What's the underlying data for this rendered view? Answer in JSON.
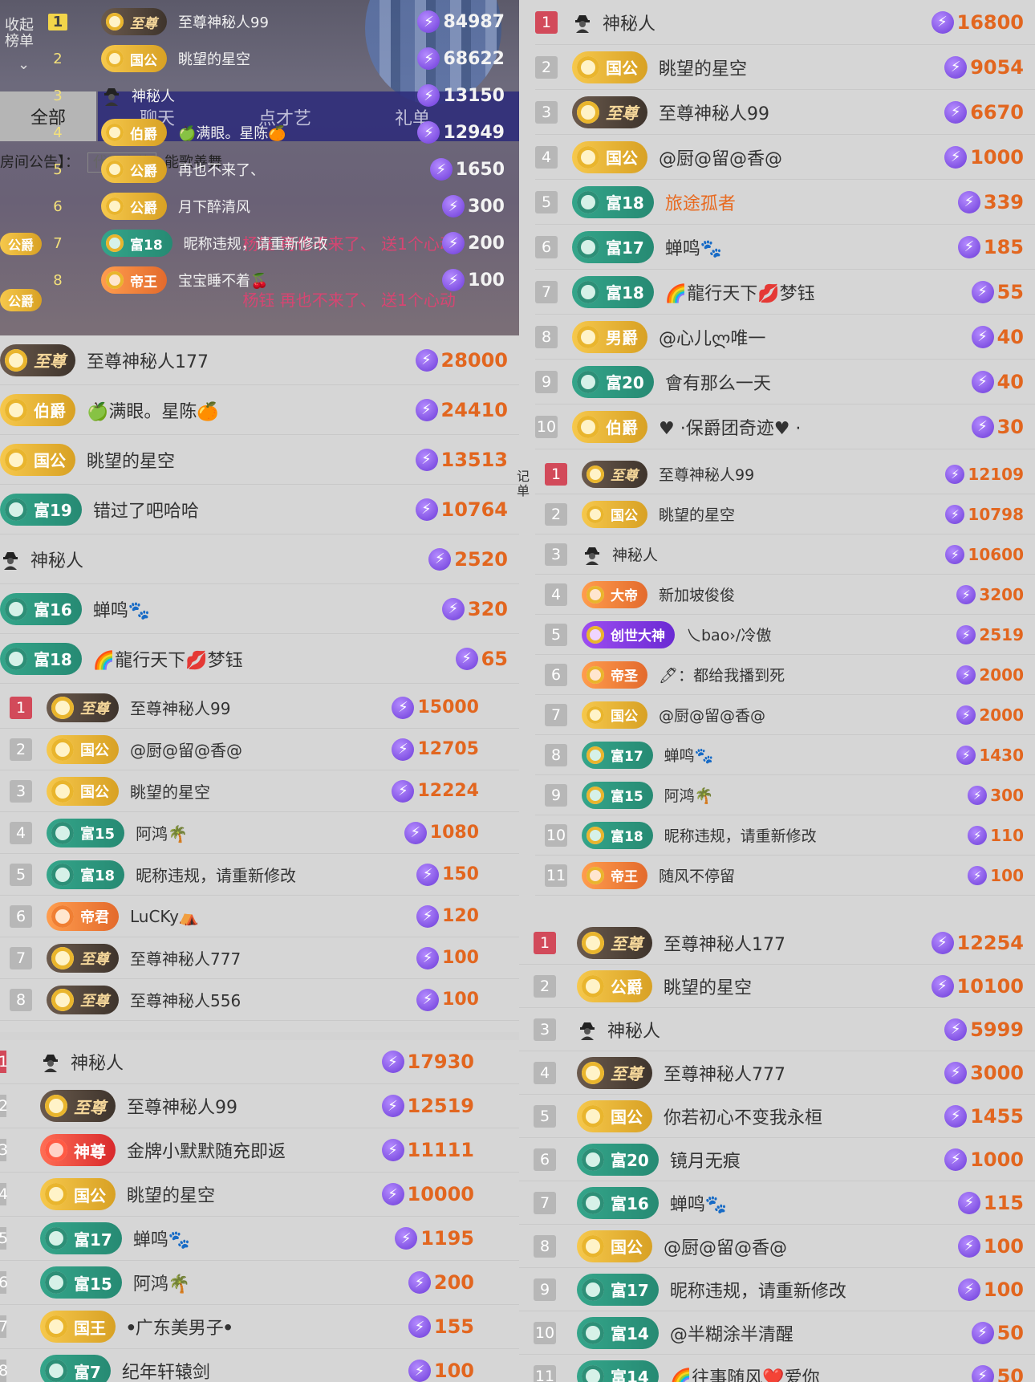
{
  "overlay": {
    "sidebar_label": "收起\n榜单",
    "tabs": {
      "all": "全部",
      "chat": "聊天",
      "talent": "点才艺",
      "gift": "礼单"
    },
    "notice_prefix": "房间公告】：",
    "notice_chip": "代理充值",
    "notice_text": "能歌善舞",
    "rows": [
      {
        "rank": "1",
        "badge": "至尊",
        "badge_type": "dark",
        "name": "至尊神秘人99",
        "score": "84987"
      },
      {
        "rank": "2",
        "badge": "国公",
        "badge_type": "gold",
        "name": "眺望的星空",
        "score": "68622"
      },
      {
        "rank": "3",
        "badge": "",
        "badge_type": "avatar",
        "name": "神秘人",
        "score": "13150"
      },
      {
        "rank": "4",
        "badge": "伯爵",
        "badge_type": "gold",
        "name": "🍏满眼。星陈🍊",
        "score": "12949"
      },
      {
        "rank": "5",
        "badge": "公爵",
        "badge_type": "gold",
        "name": "再也不来了、",
        "score": "1650"
      },
      {
        "rank": "6",
        "badge": "公爵",
        "badge_type": "gold",
        "name": "月下醉清风",
        "score": "300"
      },
      {
        "rank": "7",
        "badge": "富18",
        "badge_type": "green",
        "name": "昵称违规，请重新修改",
        "score": "200"
      },
      {
        "rank": "8",
        "badge": "帝王",
        "badge_type": "orange",
        "name": "宝宝睡不着🍒",
        "score": "100"
      }
    ],
    "chat_lines": [
      "杨钰  再也不来了、 送1个心动",
      "杨钰  再也不来了、 送1个心动"
    ],
    "chat_badges": [
      "公爵",
      "公爵"
    ]
  },
  "top_right": [
    {
      "rank": "1",
      "badge": "",
      "badge_type": "avatar",
      "name": "神秘人",
      "score": "16800"
    },
    {
      "rank": "2",
      "badge": "国公",
      "badge_type": "gold",
      "name": "眺望的星空",
      "score": "9054"
    },
    {
      "rank": "3",
      "badge": "至尊",
      "badge_type": "dark",
      "name": "至尊神秘人99",
      "score": "6670"
    },
    {
      "rank": "4",
      "badge": "国公",
      "badge_type": "gold",
      "name": "@厨@留@香@",
      "score": "1000"
    },
    {
      "rank": "5",
      "badge": "富18",
      "badge_type": "green",
      "name": "旅途孤者",
      "name_color": "orange",
      "score": "339"
    },
    {
      "rank": "6",
      "badge": "富17",
      "badge_type": "green",
      "name": "蝉鸣🐾",
      "score": "185"
    },
    {
      "rank": "7",
      "badge": "富18",
      "badge_type": "green",
      "name": "🌈龍行天下💋梦钰",
      "score": "55"
    },
    {
      "rank": "8",
      "badge": "男爵",
      "badge_type": "gold",
      "name": "@心儿ლ唯一",
      "score": "40"
    },
    {
      "rank": "9",
      "badge": "富20",
      "badge_type": "green",
      "name": "會有那么一天",
      "score": "40"
    },
    {
      "rank": "10",
      "badge": "伯爵",
      "badge_type": "gold",
      "name": "♥ ·保爵团奇迹♥ ·",
      "score": "30"
    }
  ],
  "mid_left": [
    {
      "badge": "至尊",
      "badge_type": "dark",
      "name": "至尊神秘人177",
      "score": "28000"
    },
    {
      "badge": "伯爵",
      "badge_type": "gold",
      "name": "🍏满眼。星陈🍊",
      "score": "24410"
    },
    {
      "badge": "国公",
      "badge_type": "gold",
      "name": "眺望的星空",
      "score": "13513"
    },
    {
      "badge": "富19",
      "badge_type": "green",
      "name": "错过了吧哈哈",
      "score": "10764"
    },
    {
      "badge": "",
      "badge_type": "avatar",
      "name": "神秘人",
      "score": "2520"
    },
    {
      "badge": "富16",
      "badge_type": "green",
      "name": "蝉鸣🐾",
      "score": "320"
    },
    {
      "badge": "富18",
      "badge_type": "green",
      "name": "🌈龍行天下💋梦钰",
      "score": "65"
    }
  ],
  "mid_right": [
    {
      "rank": "1",
      "badge": "至尊",
      "badge_type": "dark",
      "name": "至尊神秘人99",
      "score": "12109"
    },
    {
      "rank": "2",
      "badge": "国公",
      "badge_type": "gold",
      "name": "眺望的星空",
      "score": "10798"
    },
    {
      "rank": "3",
      "badge": "",
      "badge_type": "avatar",
      "name": "神秘人",
      "score": "10600"
    },
    {
      "rank": "4",
      "badge": "大帝",
      "badge_type": "orange",
      "name": "新加坡俊俊",
      "score": "3200"
    },
    {
      "rank": "5",
      "badge": "创世大神",
      "badge_type": "purple",
      "name": "乀bao›∕冷傲",
      "score": "2519"
    },
    {
      "rank": "6",
      "badge": "帝圣",
      "badge_type": "orange",
      "name": "🖊：都给我播到死",
      "score": "2000"
    },
    {
      "rank": "7",
      "badge": "国公",
      "badge_type": "gold",
      "name": "@厨@留@香@",
      "score": "2000"
    },
    {
      "rank": "8",
      "badge": "富17",
      "badge_type": "green",
      "name": "蝉鸣🐾",
      "score": "1430"
    },
    {
      "rank": "9",
      "badge": "富15",
      "badge_type": "green",
      "name": "阿鸿🌴",
      "score": "300"
    },
    {
      "rank": "10",
      "badge": "富18",
      "badge_type": "green",
      "name": "昵称违规，请重新修改",
      "score": "110"
    },
    {
      "rank": "11",
      "badge": "帝王",
      "badge_type": "orange",
      "name": "随风不停留",
      "score": "100"
    }
  ],
  "edge_text": "记\n单",
  "mid_left_b": [
    {
      "rank": "1",
      "badge": "至尊",
      "badge_type": "dark",
      "name": "至尊神秘人99",
      "score": "15000"
    },
    {
      "rank": "2",
      "badge": "国公",
      "badge_type": "gold",
      "name": "@厨@留@香@",
      "score": "12705"
    },
    {
      "rank": "3",
      "badge": "国公",
      "badge_type": "gold",
      "name": "眺望的星空",
      "score": "12224"
    },
    {
      "rank": "4",
      "badge": "富15",
      "badge_type": "green",
      "name": "阿鸿🌴",
      "score": "1080"
    },
    {
      "rank": "5",
      "badge": "富18",
      "badge_type": "green",
      "name": "昵称违规，请重新修改",
      "score": "150"
    },
    {
      "rank": "6",
      "badge": "帝君",
      "badge_type": "orange",
      "name": "LuCKy⛺",
      "score": "120"
    },
    {
      "rank": "7",
      "badge": "至尊",
      "badge_type": "dark",
      "name": "至尊神秘人777",
      "score": "100"
    },
    {
      "rank": "8",
      "badge": "至尊",
      "badge_type": "dark",
      "name": "至尊神秘人556",
      "score": "100"
    }
  ],
  "bottom_left": [
    {
      "rank": "1",
      "badge": "",
      "badge_type": "avatar",
      "name": "神秘人",
      "score": "17930"
    },
    {
      "rank": "2",
      "badge": "至尊",
      "badge_type": "dark",
      "name": "至尊神秘人99",
      "score": "12519"
    },
    {
      "rank": "3",
      "badge": "神尊",
      "badge_type": "red",
      "name": "金牌小默默随充即返",
      "score": "11111"
    },
    {
      "rank": "4",
      "badge": "国公",
      "badge_type": "gold",
      "name": "眺望的星空",
      "score": "10000"
    },
    {
      "rank": "5",
      "badge": "富17",
      "badge_type": "green",
      "name": "蝉鸣🐾",
      "score": "1195"
    },
    {
      "rank": "6",
      "badge": "富15",
      "badge_type": "green",
      "name": "阿鸿🌴",
      "score": "200"
    },
    {
      "rank": "7",
      "badge": "国王",
      "badge_type": "gold",
      "name": "ꔷ广东美男子ꔷ",
      "score": "155"
    },
    {
      "rank": "8",
      "badge": "富7",
      "badge_type": "green",
      "name": "纪年轩辕剑",
      "score": "100"
    }
  ],
  "bottom_right": [
    {
      "rank": "1",
      "badge": "至尊",
      "badge_type": "dark",
      "name": "至尊神秘人177",
      "score": "12254"
    },
    {
      "rank": "2",
      "badge": "公爵",
      "badge_type": "gold",
      "name": "眺望的星空",
      "score": "10100"
    },
    {
      "rank": "3",
      "badge": "",
      "badge_type": "avatar",
      "name": "神秘人",
      "score": "5999"
    },
    {
      "rank": "4",
      "badge": "至尊",
      "badge_type": "dark",
      "name": "至尊神秘人777",
      "score": "3000"
    },
    {
      "rank": "5",
      "badge": "国公",
      "badge_type": "gold",
      "name": "你若初心不变我永桓",
      "score": "1455"
    },
    {
      "rank": "6",
      "badge": "富20",
      "badge_type": "green",
      "name": "镜月无痕",
      "score": "1000"
    },
    {
      "rank": "7",
      "badge": "富16",
      "badge_type": "green",
      "name": "蝉鸣🐾",
      "score": "115"
    },
    {
      "rank": "8",
      "badge": "国公",
      "badge_type": "gold",
      "name": "@厨@留@香@",
      "score": "100"
    },
    {
      "rank": "9",
      "badge": "富17",
      "badge_type": "green",
      "name": "昵称违规，请重新修改",
      "score": "100"
    },
    {
      "rank": "10",
      "badge": "富14",
      "badge_type": "green",
      "name": "@半糊涂半清醒",
      "score": "50"
    },
    {
      "rank": "11",
      "badge": "富14",
      "badge_type": "green",
      "name": "🌈往事随风❤️爱你",
      "score": "50"
    }
  ],
  "colors": {
    "accent": "#e2661f",
    "top_rank": "#d24a5a",
    "bolt": "#6c3bd8"
  }
}
